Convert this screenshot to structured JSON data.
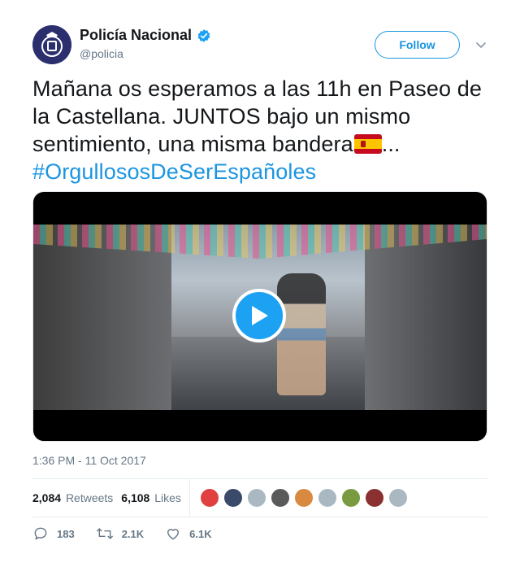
{
  "user": {
    "display_name": "Policía Nacional",
    "handle": "@policia",
    "verified": true,
    "follow_label": "Follow"
  },
  "tweet": {
    "text": "Mañana os esperamos a las 11h en Paseo de la Castellana. JUNTOS bajo un mismo sentimiento, una misma bandera",
    "emoji": "spain-flag",
    "ellipsis": "...",
    "hashtag": "#OrgullososDeSerEspañoles",
    "timestamp": "1:36 PM - 11 Oct 2017"
  },
  "stats": {
    "retweets_count": "2,084",
    "retweets_label": "Retweets",
    "likes_count": "6,108",
    "likes_label": "Likes"
  },
  "liker_avatar_colors": [
    "#e04040",
    "#3a4a6a",
    "#aab8c2",
    "#5a5a5a",
    "#d88a40",
    "#aab8c2",
    "#7a9a40",
    "#8a3030",
    "#aab8c2"
  ],
  "actions": {
    "replies": "183",
    "retweets": "2.1K",
    "likes": "6.1K"
  },
  "colors": {
    "accent": "#1da1f2",
    "link": "#1b95e0",
    "muted": "#657786"
  }
}
